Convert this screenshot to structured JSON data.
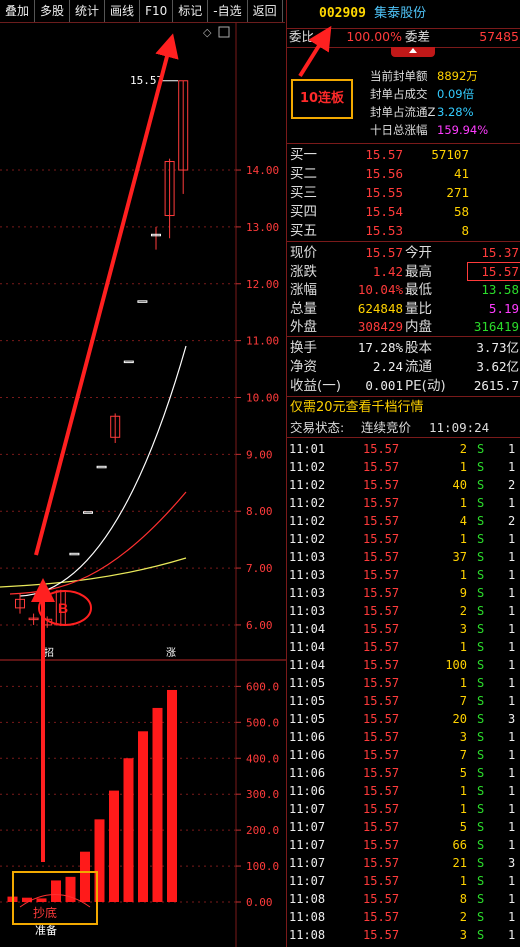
{
  "toolbar": [
    "叠加",
    "多股",
    "统计",
    "画线",
    "F10",
    "标记",
    "-自选",
    "返回"
  ],
  "stock": {
    "code": "002909",
    "name": "集泰股份"
  },
  "weibi": {
    "label": "委比",
    "value": "100.00%",
    "label2": "委差",
    "value2": "57485"
  },
  "seal_info": [
    {
      "label": "当前封单额",
      "value": "8892万"
    },
    {
      "label": "封单占成交",
      "value": "0.09倍"
    },
    {
      "label": "封单占流通Z",
      "value": "3.28%"
    },
    {
      "label": "十日总涨幅",
      "value": "159.94%"
    }
  ],
  "annotation_box": "10连板",
  "annotation_circle": "B",
  "bids": [
    {
      "label": "买一",
      "price": "15.57",
      "vol": "57107"
    },
    {
      "label": "买二",
      "price": "15.56",
      "vol": "41"
    },
    {
      "label": "买三",
      "price": "15.55",
      "vol": "271"
    },
    {
      "label": "买四",
      "price": "15.54",
      "vol": "58"
    },
    {
      "label": "买五",
      "price": "15.53",
      "vol": "8"
    }
  ],
  "quote": [
    {
      "l1": "现价",
      "v1": "15.57",
      "l2": "今开",
      "v2": "15.37"
    },
    {
      "l1": "涨跌",
      "v1": "1.42",
      "l2": "最高",
      "v2": "15.57"
    },
    {
      "l1": "涨幅",
      "v1": "10.04%",
      "l2": "最低",
      "v2": "13.58"
    },
    {
      "l1": "总量",
      "v1": "624848",
      "l2": "量比",
      "v2": "5.19"
    },
    {
      "l1": "外盘",
      "v1": "308429",
      "l2": "内盘",
      "v2": "316419"
    }
  ],
  "fundamentals": [
    {
      "l1": "换手",
      "v1": "17.28%",
      "l2": "股本",
      "v2": "3.73亿"
    },
    {
      "l1": "净资",
      "v1": "2.24",
      "l2": "流通",
      "v2": "3.62亿"
    },
    {
      "l1": "收益(一)",
      "v1": "0.001",
      "l2": "PE(动)",
      "v2": "2615.7"
    }
  ],
  "promo": "仅需20元查看千档行情",
  "trade_status": {
    "label": "交易状态:",
    "value": "连续竞价",
    "time": "11:09:24"
  },
  "ticks": [
    {
      "t": "11:01",
      "p": "15.57",
      "v": "2",
      "s": "S",
      "n": "1"
    },
    {
      "t": "11:02",
      "p": "15.57",
      "v": "1",
      "s": "S",
      "n": "1"
    },
    {
      "t": "11:02",
      "p": "15.57",
      "v": "40",
      "s": "S",
      "n": "2"
    },
    {
      "t": "11:02",
      "p": "15.57",
      "v": "1",
      "s": "S",
      "n": "1"
    },
    {
      "t": "11:02",
      "p": "15.57",
      "v": "4",
      "s": "S",
      "n": "2"
    },
    {
      "t": "11:02",
      "p": "15.57",
      "v": "1",
      "s": "S",
      "n": "1"
    },
    {
      "t": "11:03",
      "p": "15.57",
      "v": "37",
      "s": "S",
      "n": "1"
    },
    {
      "t": "11:03",
      "p": "15.57",
      "v": "1",
      "s": "S",
      "n": "1"
    },
    {
      "t": "11:03",
      "p": "15.57",
      "v": "9",
      "s": "S",
      "n": "1"
    },
    {
      "t": "11:03",
      "p": "15.57",
      "v": "2",
      "s": "S",
      "n": "1"
    },
    {
      "t": "11:04",
      "p": "15.57",
      "v": "3",
      "s": "S",
      "n": "1"
    },
    {
      "t": "11:04",
      "p": "15.57",
      "v": "1",
      "s": "S",
      "n": "1"
    },
    {
      "t": "11:04",
      "p": "15.57",
      "v": "100",
      "s": "S",
      "n": "1"
    },
    {
      "t": "11:05",
      "p": "15.57",
      "v": "1",
      "s": "S",
      "n": "1"
    },
    {
      "t": "11:05",
      "p": "15.57",
      "v": "7",
      "s": "S",
      "n": "1"
    },
    {
      "t": "11:05",
      "p": "15.57",
      "v": "20",
      "s": "S",
      "n": "3"
    },
    {
      "t": "11:06",
      "p": "15.57",
      "v": "3",
      "s": "S",
      "n": "1"
    },
    {
      "t": "11:06",
      "p": "15.57",
      "v": "7",
      "s": "S",
      "n": "1"
    },
    {
      "t": "11:06",
      "p": "15.57",
      "v": "5",
      "s": "S",
      "n": "1"
    },
    {
      "t": "11:06",
      "p": "15.57",
      "v": "1",
      "s": "S",
      "n": "1"
    },
    {
      "t": "11:07",
      "p": "15.57",
      "v": "1",
      "s": "S",
      "n": "1"
    },
    {
      "t": "11:07",
      "p": "15.57",
      "v": "5",
      "s": "S",
      "n": "1"
    },
    {
      "t": "11:07",
      "p": "15.57",
      "v": "66",
      "s": "S",
      "n": "1"
    },
    {
      "t": "11:07",
      "p": "15.57",
      "v": "21",
      "s": "S",
      "n": "3"
    },
    {
      "t": "11:07",
      "p": "15.57",
      "v": "1",
      "s": "S",
      "n": "1"
    },
    {
      "t": "11:08",
      "p": "15.57",
      "v": "8",
      "s": "S",
      "n": "1"
    },
    {
      "t": "11:08",
      "p": "15.57",
      "v": "2",
      "s": "S",
      "n": "1"
    },
    {
      "t": "11:08",
      "p": "15.57",
      "v": "3",
      "s": "S",
      "n": "1"
    }
  ],
  "chart_labels": {
    "price_marker": "15.57",
    "zhang_marker": "涨",
    "small_marker": "招",
    "kline_label": "抄底",
    "kline_label2": "准备"
  },
  "colors": {
    "up": "#ff3b3b",
    "down": "#2bdc2b",
    "bg": "#000000",
    "accent": "#ffd700"
  },
  "chart_data": [
    {
      "type": "candlestick",
      "title": "",
      "y_ticks": [
        "14.00",
        "13.00",
        "12.00",
        "11.00",
        "10.00",
        "9.00",
        "8.00",
        "7.00",
        "6.00"
      ],
      "ylim": [
        5.7,
        15.9
      ],
      "candles": [
        {
          "open": 6.3,
          "close": 6.45,
          "high": 6.55,
          "low": 6.2
        },
        {
          "open": 6.1,
          "close": 6.12,
          "high": 6.2,
          "low": 6.0
        },
        {
          "open": 6.0,
          "close": 6.1,
          "high": 6.15,
          "low": 5.95
        },
        {
          "open": 6.0,
          "close": 6.6,
          "high": 6.62,
          "low": 5.98
        },
        {
          "open": 7.26,
          "close": 7.26,
          "high": 7.26,
          "low": 7.26
        },
        {
          "open": 7.99,
          "close": 7.99,
          "high": 7.99,
          "low": 7.99
        },
        {
          "open": 8.79,
          "close": 8.79,
          "high": 8.79,
          "low": 8.79
        },
        {
          "open": 9.3,
          "close": 9.67,
          "high": 9.72,
          "low": 9.2
        },
        {
          "open": 10.64,
          "close": 10.64,
          "high": 10.64,
          "low": 10.64
        },
        {
          "open": 11.7,
          "close": 11.7,
          "high": 11.7,
          "low": 11.7
        },
        {
          "open": 12.87,
          "close": 12.87,
          "high": 13.0,
          "low": 12.6
        },
        {
          "open": 13.2,
          "close": 14.15,
          "high": 14.2,
          "low": 12.8
        },
        {
          "open": 14.0,
          "close": 15.57,
          "high": 15.57,
          "low": 13.58
        }
      ]
    },
    {
      "type": "bar",
      "title": "",
      "y_ticks": [
        "600.0",
        "500.0",
        "400.0",
        "300.0",
        "200.0",
        "100.0",
        "0.00"
      ],
      "ylim": [
        0,
        640
      ],
      "values": [
        15,
        12,
        10,
        60,
        70,
        140,
        230,
        310,
        400,
        475,
        540,
        590
      ]
    }
  ]
}
